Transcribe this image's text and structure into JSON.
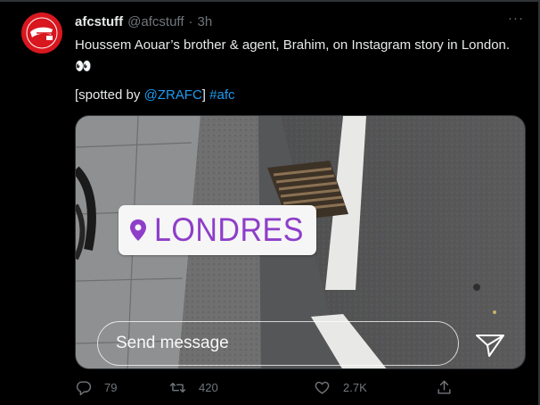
{
  "tweet": {
    "display_name": "afcstuff",
    "handle": "@afcstuff",
    "separator": "·",
    "time": "3h",
    "more_label": "···",
    "text": "Houssem Aouar’s brother & agent, Brahim, on Instagram story in London.",
    "emoji": "👀",
    "spotted_prefix": "[spotted by ",
    "mention": "@ZRAFC",
    "spotted_suffix": "]",
    "hashtag": "#afc"
  },
  "media": {
    "location_label": "LONDRES",
    "send_placeholder": "Send message"
  },
  "actions": {
    "replies": "79",
    "retweets": "420",
    "likes": "2.7K"
  },
  "colors": {
    "background": "#000000",
    "link": "#1d9bf0",
    "muted": "#71767b",
    "avatar": "#d8171f",
    "sticker_text": "#8e3ec9"
  },
  "icons": [
    "avatar-logo",
    "more-icon",
    "location-pin-icon",
    "send-arrow-icon",
    "reply-icon",
    "retweet-icon",
    "like-icon",
    "share-icon"
  ]
}
